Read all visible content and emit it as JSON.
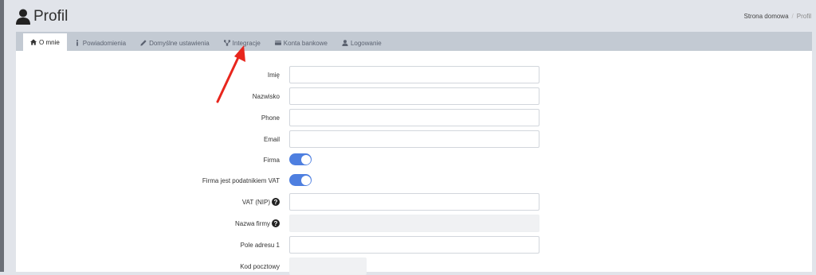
{
  "header": {
    "title": "Profil"
  },
  "breadcrumb": {
    "home": "Strona domowa",
    "separator": "/",
    "current": "Profil"
  },
  "tabs": [
    {
      "label": "O mnie",
      "icon": "home-icon",
      "active": true
    },
    {
      "label": "Powiadomienia",
      "icon": "info-icon"
    },
    {
      "label": "Domyślne ustawienia",
      "icon": "pencil-icon"
    },
    {
      "label": "Integracje",
      "icon": "sitemap-icon"
    },
    {
      "label": "Konta bankowe",
      "icon": "credit-card-icon"
    },
    {
      "label": "Logowanie",
      "icon": "user-icon"
    }
  ],
  "form": {
    "imie": {
      "label": "Imię",
      "value": ""
    },
    "nazwisko": {
      "label": "Nazwisko",
      "value": ""
    },
    "phone": {
      "label": "Phone",
      "value": ""
    },
    "email": {
      "label": "Email",
      "value": ""
    },
    "firma": {
      "label": "Firma",
      "checked": true
    },
    "vat_payer": {
      "label": "Firma jest podatnikiem VAT",
      "checked": true
    },
    "vat_nip": {
      "label": "VAT (NIP)",
      "value": ""
    },
    "company_name": {
      "label": "Nazwa firmy",
      "value": ""
    },
    "address1": {
      "label": "Pole adresu 1",
      "value": ""
    },
    "postal_code": {
      "label": "Kod pocztowy",
      "value": ""
    }
  },
  "colors": {
    "accent": "#4e7fe0",
    "tabbar": "#c3cad3",
    "background": "#e1e4ea",
    "annotation": "#e8261d"
  }
}
